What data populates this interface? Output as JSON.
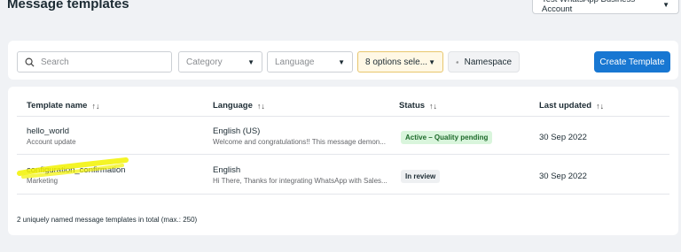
{
  "header": {
    "title": "Message templates",
    "account_selector": "Test WhatsApp Business Account"
  },
  "filters": {
    "search_placeholder": "Search",
    "category": "Category",
    "language": "Language",
    "status": "8 options sele...",
    "namespace_label": "Namespace",
    "create_label": "Create Template"
  },
  "table": {
    "columns": [
      "Template name",
      "Language",
      "Status",
      "Last updated"
    ],
    "rows": [
      {
        "name": "hello_world",
        "category": "Account update",
        "language": "English (US)",
        "preview": "Welcome and congratulations!! This message demon...",
        "status": "Active – Quality pending",
        "updated": "30 Sep 2022"
      },
      {
        "name": "configuration_confirmation",
        "category": "Marketing",
        "language": "English",
        "preview": "Hi There, Thanks for integrating WhatsApp with Sales...",
        "status": "In review",
        "updated": "30 Sep 2022"
      }
    ],
    "footer": "2 uniquely named message templates in total (max.: 250)"
  },
  "colors": {
    "primary": "#1877d2",
    "active_badge": "#d9f5dc",
    "highlight": "#f2f200"
  }
}
